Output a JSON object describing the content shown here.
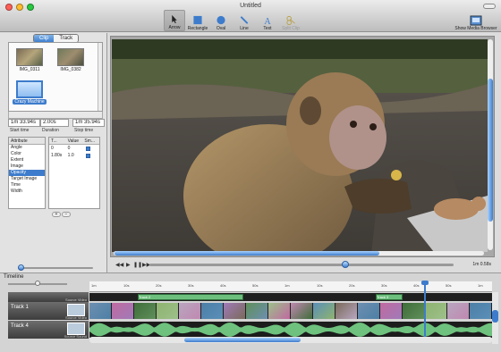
{
  "window": {
    "title": "Untitled"
  },
  "toolbar": {
    "tools": [
      {
        "label": "Arrow",
        "icon": "arrow-icon"
      },
      {
        "label": "Rectangle",
        "icon": "rectangle-icon"
      },
      {
        "label": "Oval",
        "icon": "oval-icon"
      },
      {
        "label": "Line",
        "icon": "line-icon"
      },
      {
        "label": "Text",
        "icon": "text-icon"
      },
      {
        "label": "Split Clip",
        "icon": "split-clip-icon"
      }
    ],
    "media_browser": "Show Media Browser"
  },
  "inspector": {
    "tabs": [
      "Clip",
      "Track"
    ],
    "clips": [
      {
        "label": "IMG_0311"
      },
      {
        "label": "IMG_0382"
      },
      {
        "label": "Crazy Machine"
      }
    ],
    "start_time": "1m 33.94s",
    "duration": "2.00s",
    "stop_time": "1m 35.94s",
    "start_label": "Start time",
    "duration_label": "Duration",
    "stop_label": "Stop time",
    "attribute_header": "Attribute",
    "attributes": [
      "Angle",
      "Color",
      "Extent",
      "Image",
      "Opacity",
      "Target Image",
      "Time",
      "Width"
    ],
    "selected_attribute": "Opacity",
    "keyframe_headers": [
      "T...",
      "Value",
      "Sm..."
    ],
    "keyframes": [
      {
        "time": "0",
        "value": "0"
      },
      {
        "time": "1.80s",
        "value": "1.0"
      }
    ],
    "slider_value": "0"
  },
  "transport": {
    "timecode": "1m 0.58s"
  },
  "timeline": {
    "label": "Timeline",
    "ruler_ticks": [
      "1m",
      "10s",
      "20s",
      "30s",
      "40s",
      "50s",
      "1m",
      "10s",
      "20s",
      "30s",
      "40s",
      "50s",
      "1m"
    ],
    "tracks": [
      {
        "name": "Track 1",
        "source": "Source Video"
      },
      {
        "name": "Track 4",
        "source": "Source Sound"
      }
    ],
    "overlay_source": "Source Video",
    "overlay_labels": [
      "Track 2",
      "Track 3"
    ]
  }
}
